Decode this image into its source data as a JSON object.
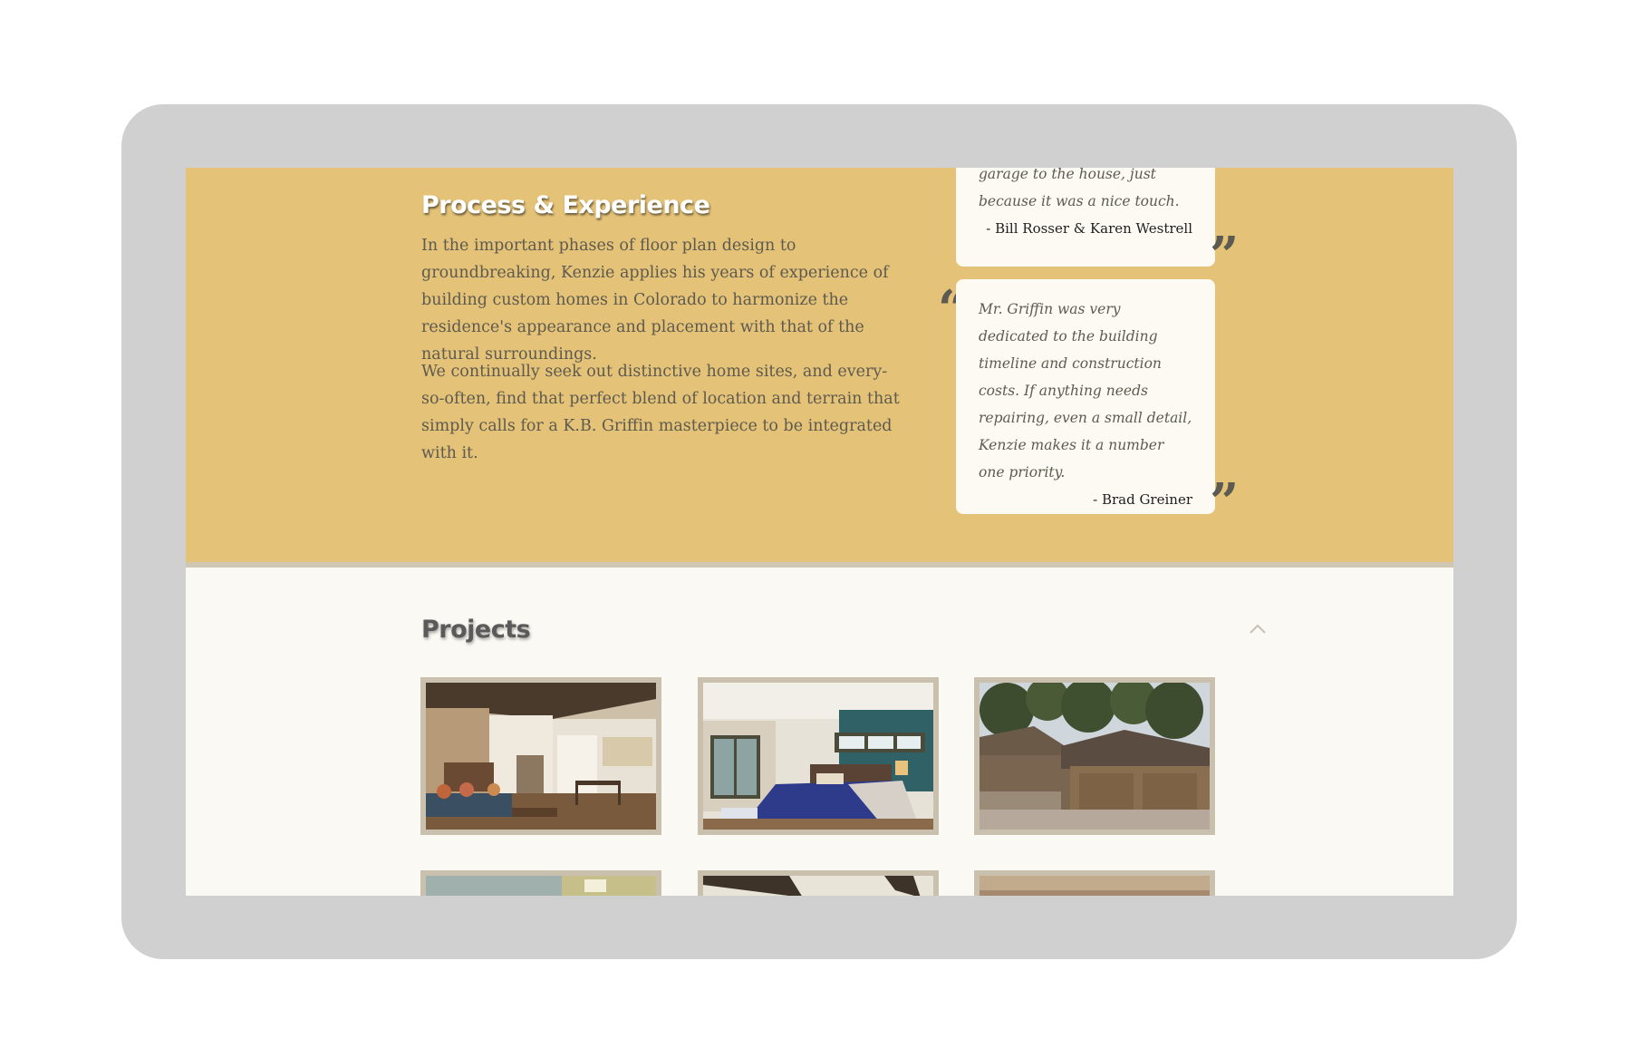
{
  "process": {
    "title": "Process & Experience",
    "paragraphs": [
      "In the important phases of floor plan design to groundbreaking, Kenzie applies his years of experience of building custom homes in Colorado to harmonize the residence's appearance and placement with that of the natural surroundings.",
      "We continually seek out distinctive home sites, and every-so-often, find that perfect blend of location and terrain that simply calls for a K.B. Griffin masterpiece to be integrated with it."
    ]
  },
  "testimonials": [
    {
      "quote": "garage to the house, just because it was a nice touch.",
      "author": "- Bill Rosser & Karen Westrell"
    },
    {
      "quote": "Mr. Griffin was very dedicated to the building timeline and construction costs. If anything needs repairing, even a small detail, Kenzie makes it a number one priority.",
      "author": "- Brad Greiner"
    }
  ],
  "quote_marks": {
    "open": "“",
    "close": "”"
  },
  "projects": {
    "title": "Projects",
    "collapse_icon": "chevron-up-icon",
    "thumbnails": [
      {
        "name": "project-thumbnail-great-room"
      },
      {
        "name": "project-thumbnail-bedroom"
      },
      {
        "name": "project-thumbnail-exterior-garage"
      },
      {
        "name": "project-thumbnail-4"
      },
      {
        "name": "project-thumbnail-5"
      },
      {
        "name": "project-thumbnail-6"
      }
    ]
  },
  "colors": {
    "process_background": "#e4c277",
    "projects_background": "#fbf9f3",
    "device_frame": "#d0d0d0",
    "thumbnail_border": "#c9c1ae",
    "card_background": "#fcfaf3"
  }
}
